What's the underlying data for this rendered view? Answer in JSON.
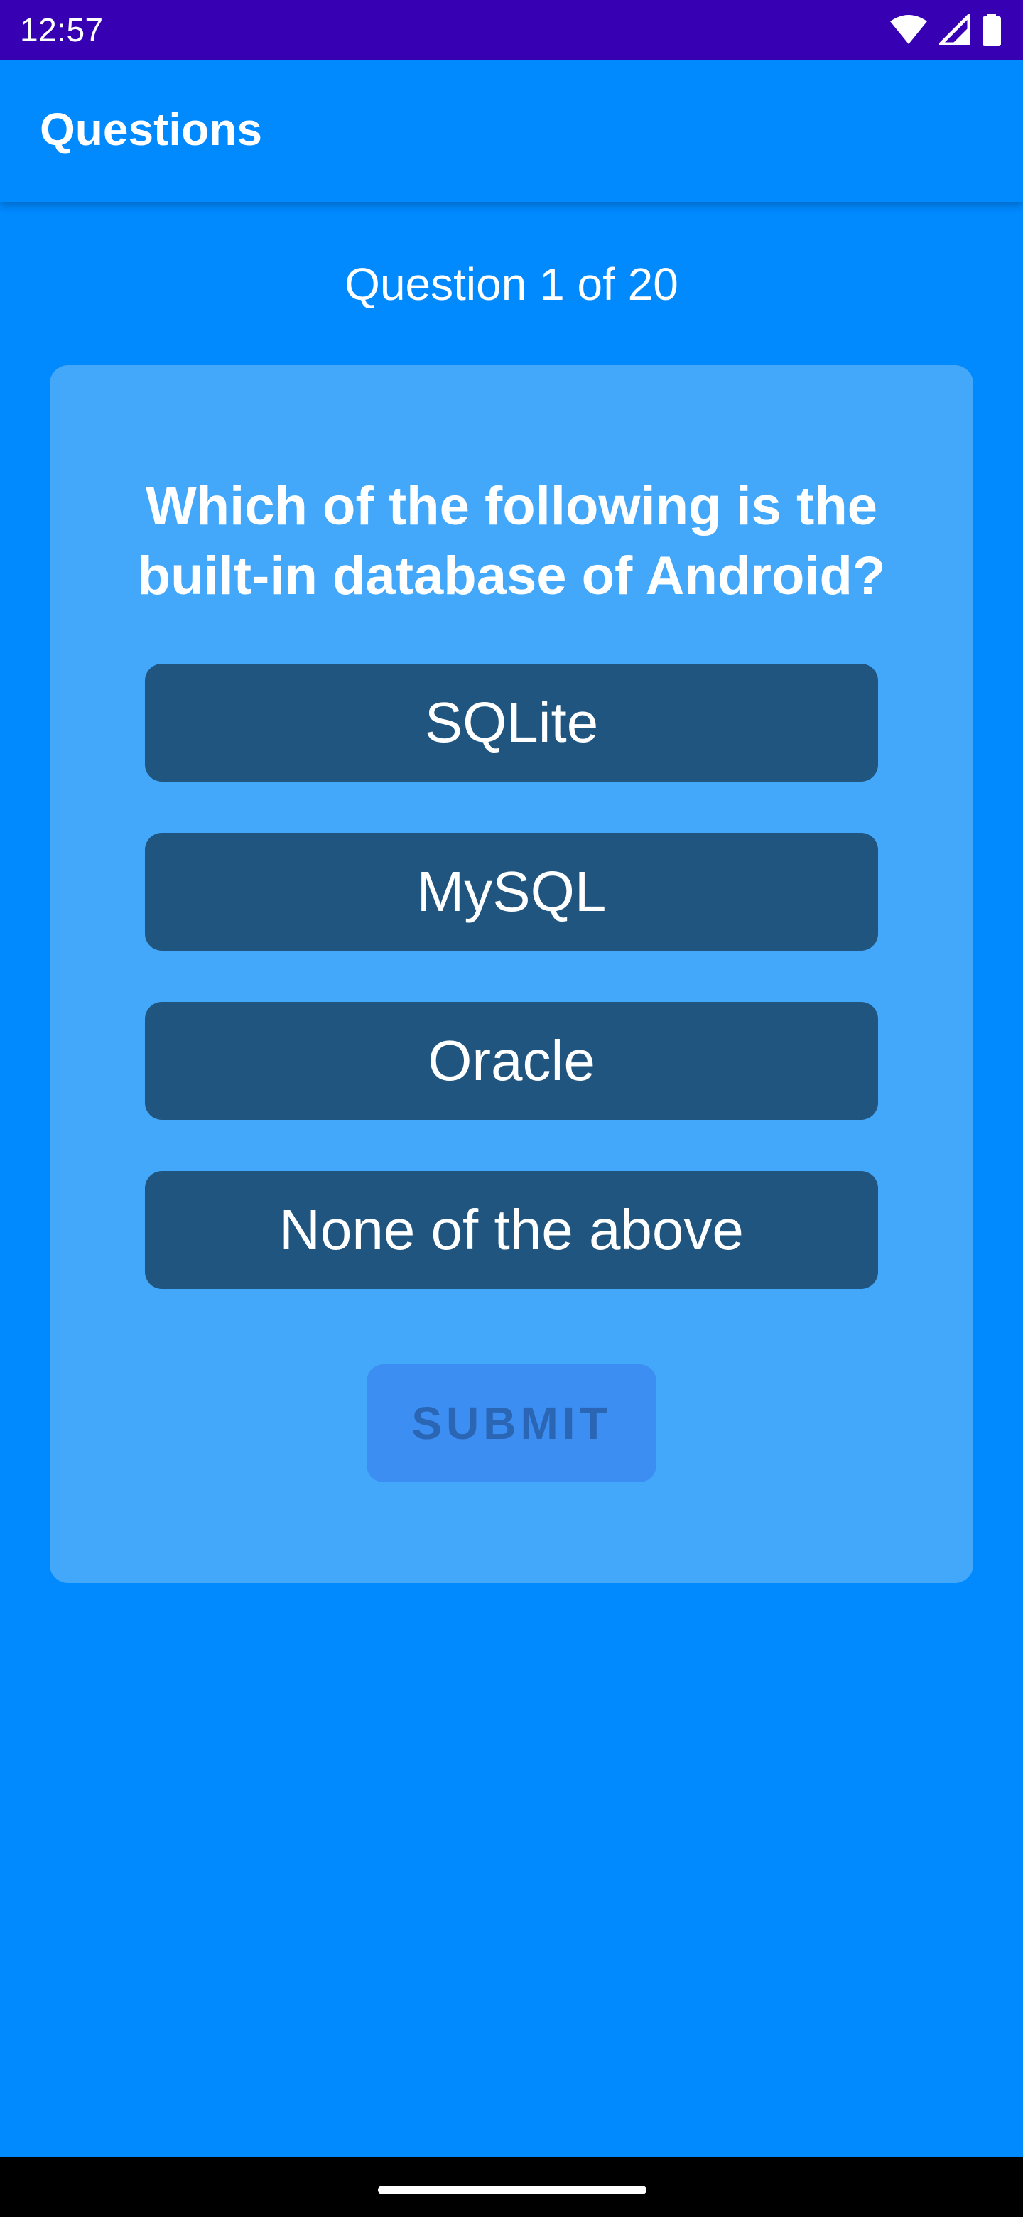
{
  "status_bar": {
    "time": "12:57",
    "icons": [
      "wifi-icon",
      "cellular-signal-icon",
      "battery-icon"
    ]
  },
  "app_bar": {
    "title": "Questions"
  },
  "quiz": {
    "counter": "Question 1 of 20",
    "question": "Which of the following is the built-in database of Android?",
    "options": [
      {
        "label": "SQLite"
      },
      {
        "label": "MySQL"
      },
      {
        "label": "Oracle"
      },
      {
        "label": "None of the above"
      }
    ],
    "submit_label": "SUBMIT",
    "submit_enabled": false
  },
  "colors": {
    "status_bar": "#3700B3",
    "background": "#0189FE",
    "card": "#44A8FA",
    "option_button": "#1F557F",
    "submit_button_disabled": "#3D8EF2",
    "submit_text_disabled": "#2A66B4"
  }
}
